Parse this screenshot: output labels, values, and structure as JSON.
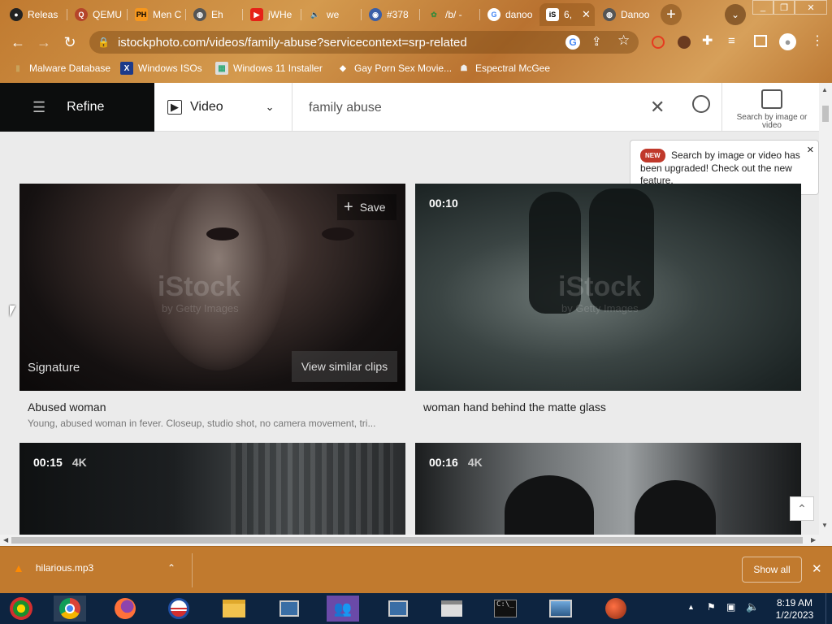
{
  "tabs": [
    {
      "label": "Releas",
      "icon": "github-icon"
    },
    {
      "label": "QEMU",
      "icon": "qemu-icon"
    },
    {
      "label": "Men C",
      "icon": "ph-icon"
    },
    {
      "label": "Eh",
      "icon": "globe-icon"
    },
    {
      "label": "jWHe",
      "icon": "youtube-icon"
    },
    {
      "label": "we",
      "icon": "tab-icon"
    },
    {
      "label": "#378",
      "icon": "tab-icon"
    },
    {
      "label": "/b/ -",
      "icon": "tab-icon"
    },
    {
      "label": "danoo",
      "icon": "google-icon"
    },
    {
      "label": "6,",
      "icon": "istock-icon",
      "active": true
    },
    {
      "label": "Danoo",
      "icon": "globe-icon"
    }
  ],
  "address": "istockphoto.com/videos/family-abuse?servicecontext=srp-related",
  "bookmarks": [
    {
      "label": "Malware Database"
    },
    {
      "label": "Windows ISOs"
    },
    {
      "label": "Windows 11 Installer"
    },
    {
      "label": "Gay Porn Sex Movie..."
    },
    {
      "label": "Espectral McGee"
    }
  ],
  "search": {
    "refine": "Refine",
    "media_type": "Video",
    "query": "family abuse",
    "image_search_label": "Search by image or video"
  },
  "tooltip": {
    "badge": "NEW",
    "text": "Search by image or video has been upgraded! Check out the new feature."
  },
  "results": [
    {
      "label": "Signature",
      "save": "Save",
      "similar": "View similar clips",
      "title": "Abused woman",
      "desc": "Young, abused woman in fever. Closeup, studio shot, no camera movement, tri...",
      "watermark": "iStock",
      "watermark_sub": "by Getty Images"
    },
    {
      "duration": "00:10",
      "title": "woman hand behind the matte glass",
      "watermark": "iStock",
      "watermark_sub": "by Getty Images"
    },
    {
      "duration": "00:15",
      "quality": "4K"
    },
    {
      "duration": "00:16",
      "quality": "4K"
    }
  ],
  "download": {
    "file": "hilarious.mp3",
    "show_all": "Show all"
  },
  "clock": {
    "time": "8:19 AM",
    "date": "1/2/2023"
  }
}
